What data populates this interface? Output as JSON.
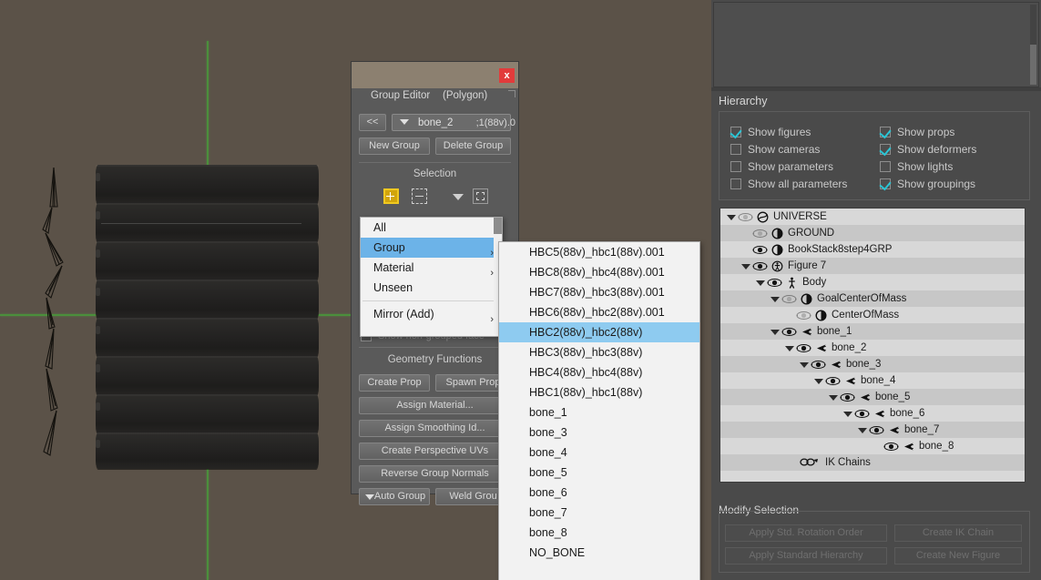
{
  "viewport": {
    "name": "3d-viewport",
    "background_color": "#5b5248",
    "axis_color": "#4b8f3c",
    "book_color": "#262523",
    "book_count": 8
  },
  "group_editor": {
    "window_title": "",
    "close_label": "x",
    "tab_label": "Group Editor",
    "mode_label": "(Polygon)",
    "prev_button": "<<",
    "group_field_value": "bone_2",
    "group_field_overflow": ";1(88v).0",
    "new_group": "New Group",
    "delete_group": "Delete Group",
    "selection_title": "Selection",
    "selection_icons": [
      "add-selection-icon",
      "subtract-selection-icon",
      "selection-mode-dropdown-icon",
      "marquee-selection-icon"
    ],
    "show_non_grouped_label": "Show non-grouped face",
    "geometry_title": "Geometry Functions",
    "buttons": {
      "create_prop": "Create Prop",
      "spawn_props": "Spawn Prop",
      "assign_material": "Assign Material...",
      "assign_smoothing": "Assign Smoothing Id...",
      "create_uvs": "Create Perspective UVs",
      "reverse_normals": "Reverse Group Normals",
      "auto_group": "Auto Group",
      "weld_group": "Weld Grou"
    }
  },
  "menu_primary": {
    "name": "selection-type-menu",
    "items": [
      {
        "label": "All",
        "submenu": false,
        "highlighted": false
      },
      {
        "label": "Group",
        "submenu": true,
        "highlighted": true
      },
      {
        "label": "Material",
        "submenu": true,
        "highlighted": false
      },
      {
        "label": "Unseen",
        "submenu": false,
        "highlighted": false
      },
      {
        "label": "Mirror (Add)",
        "submenu": true,
        "highlighted": false
      }
    ],
    "submenu_arrow": "›"
  },
  "menu_group_submenu": {
    "name": "group-submenu",
    "items": [
      {
        "label": "HBC5(88v)_hbc1(88v).001",
        "highlighted": false
      },
      {
        "label": "HBC8(88v)_hbc4(88v).001",
        "highlighted": false
      },
      {
        "label": "HBC7(88v)_hbc3(88v).001",
        "highlighted": false
      },
      {
        "label": "HBC6(88v)_hbc2(88v).001",
        "highlighted": false
      },
      {
        "label": "HBC2(88v)_hbc2(88v)",
        "highlighted": true
      },
      {
        "label": "HBC3(88v)_hbc3(88v)",
        "highlighted": false
      },
      {
        "label": "HBC4(88v)_hbc4(88v)",
        "highlighted": false
      },
      {
        "label": "HBC1(88v)_hbc1(88v)",
        "highlighted": false
      },
      {
        "label": "bone_1",
        "highlighted": false
      },
      {
        "label": "bone_3",
        "highlighted": false
      },
      {
        "label": "bone_4",
        "highlighted": false
      },
      {
        "label": "bone_5",
        "highlighted": false
      },
      {
        "label": "bone_6",
        "highlighted": false
      },
      {
        "label": "bone_7",
        "highlighted": false
      },
      {
        "label": "bone_8",
        "highlighted": false
      },
      {
        "label": "NO_BONE",
        "highlighted": false
      }
    ],
    "highlight_color": "#8ecbf0"
  },
  "hierarchy_panel": {
    "title": "Hierarchy",
    "checkboxes_left": [
      {
        "label": "Show figures",
        "checked": true
      },
      {
        "label": "Show cameras",
        "checked": false
      },
      {
        "label": "Show parameters",
        "checked": false
      },
      {
        "label": "Show all parameters",
        "checked": false
      }
    ],
    "checkboxes_right": [
      {
        "label": "Show props",
        "checked": true
      },
      {
        "label": "Show deformers",
        "checked": true
      },
      {
        "label": "Show lights",
        "checked": false
      },
      {
        "label": "Show groupings",
        "checked": true
      }
    ],
    "check_color": "#29c6d6",
    "tree": [
      {
        "label": "UNIVERSE",
        "depth": 0,
        "triangle": true,
        "eye": "dim",
        "icon": "universe-icon"
      },
      {
        "label": "GROUND",
        "depth": 1,
        "triangle": false,
        "eye": "dim",
        "icon": "prop-icon"
      },
      {
        "label": "BookStack8step4GRP",
        "depth": 1,
        "triangle": false,
        "eye": "on",
        "icon": "prop-icon"
      },
      {
        "label": "Figure 7",
        "depth": 1,
        "triangle": true,
        "eye": "on",
        "icon": "figure-icon"
      },
      {
        "label": "Body",
        "depth": 2,
        "triangle": true,
        "eye": "on",
        "icon": "body-icon"
      },
      {
        "label": "GoalCenterOfMass",
        "depth": 3,
        "triangle": true,
        "eye": "dim",
        "icon": "prop-icon"
      },
      {
        "label": "CenterOfMass",
        "depth": 4,
        "triangle": false,
        "eye": "dim",
        "icon": "prop-icon"
      },
      {
        "label": "bone_1",
        "depth": 3,
        "triangle": true,
        "eye": "on",
        "icon": "bone-icon"
      },
      {
        "label": "bone_2",
        "depth": 4,
        "triangle": true,
        "eye": "on",
        "icon": "bone-icon"
      },
      {
        "label": "bone_3",
        "depth": 5,
        "triangle": true,
        "eye": "on",
        "icon": "bone-icon"
      },
      {
        "label": "bone_4",
        "depth": 6,
        "triangle": true,
        "eye": "on",
        "icon": "bone-icon"
      },
      {
        "label": "bone_5",
        "depth": 7,
        "triangle": true,
        "eye": "on",
        "icon": "bone-icon"
      },
      {
        "label": "bone_6",
        "depth": 8,
        "triangle": true,
        "eye": "on",
        "icon": "bone-icon"
      },
      {
        "label": "bone_7",
        "depth": 9,
        "triangle": true,
        "eye": "on",
        "icon": "bone-icon"
      },
      {
        "label": "bone_8",
        "depth": 10,
        "triangle": false,
        "eye": "on",
        "icon": "bone-icon"
      },
      {
        "label": "IK Chains",
        "depth": 3,
        "triangle": false,
        "eye": "none",
        "icon": "ikchain-icon"
      }
    ]
  },
  "modify_selection": {
    "title": "Modify Selection",
    "buttons": [
      "Apply Std. Rotation Order",
      "Create IK Chain",
      "Apply Standard Hierarchy",
      "Create New Figure"
    ]
  }
}
